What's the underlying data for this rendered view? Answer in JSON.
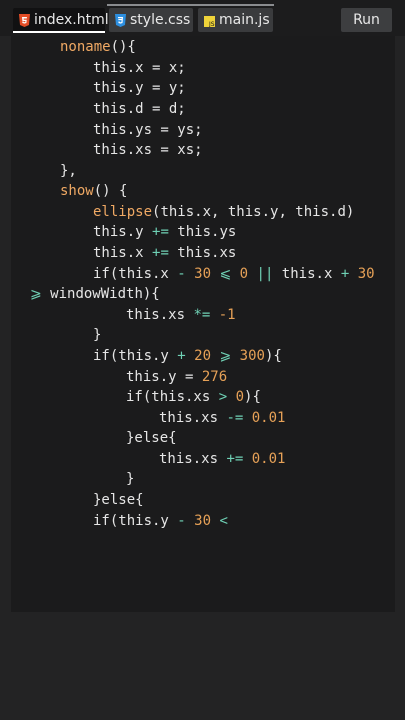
{
  "tabs": [
    {
      "label": "index.html",
      "icon": "html5-icon",
      "active": true
    },
    {
      "label": "style.css",
      "icon": "css3-icon",
      "active": false
    },
    {
      "label": "main.js",
      "icon": "javascript-icon",
      "active": false
    }
  ],
  "run_label": "Run",
  "colors": {
    "text": "#e6e6e6",
    "function": "#f0a964",
    "number": "#e6a157",
    "operator": "#6fd1b5",
    "editor_bg": "#1b1b1c"
  },
  "code_lines": [
    {
      "text": "noname(){"
    },
    {
      "text": "this.x = x;"
    },
    {
      "text": "this.y = y;"
    },
    {
      "text": "this.d = d;"
    },
    {
      "text": "this.ys = ys;"
    },
    {
      "text": "this.xs = xs;"
    },
    {
      "text": "},"
    },
    {
      "text": "show() {"
    },
    {
      "text": "ellipse(this.x, this.y, this.d)"
    },
    {
      "text": "this.y += this.ys"
    },
    {
      "text": "this.x += this.xs"
    },
    {
      "text": "if(this.x - 30 ⩽ 0 || this.x + 30"
    },
    {
      "text": "⩾ windowWidth){"
    },
    {
      "text": "this.xs *= -1"
    },
    {
      "text": "}"
    },
    {
      "text": "if(this.y + 20 ⩾ 300){"
    },
    {
      "text": "this.y = 276"
    },
    {
      "text": "if(this.xs > 0){"
    },
    {
      "text": "this.xs -= 0.01"
    },
    {
      "text": "}else{"
    },
    {
      "text": "this.xs += 0.01"
    },
    {
      "text": "}"
    },
    {
      "text": "}else{"
    },
    {
      "text": "if(this.y - 30 <"
    }
  ]
}
